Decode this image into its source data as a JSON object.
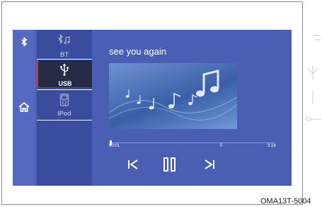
{
  "sources": {
    "bt_label": "BT",
    "usb_label": "USB",
    "ipod_label": "iPod"
  },
  "player": {
    "song_title": "see you again",
    "current_time": "00:01",
    "marker_value": "0",
    "total_time": "3:16",
    "progress_fraction": 0.005
  },
  "icons": {
    "rail_top": "bluetooth-icon",
    "rail_home": "home-icon",
    "bt": "bluetooth-music-icon",
    "usb": "usb-icon",
    "ipod": "ipod-icon",
    "prev": "previous-track-icon",
    "pause": "pause-icon",
    "next": "next-track-icon"
  },
  "colors": {
    "screen": "#4a5fb4",
    "active_source": "#262c45",
    "active_marker": "#cc3b3b"
  },
  "caption": "OMA13T-5004"
}
